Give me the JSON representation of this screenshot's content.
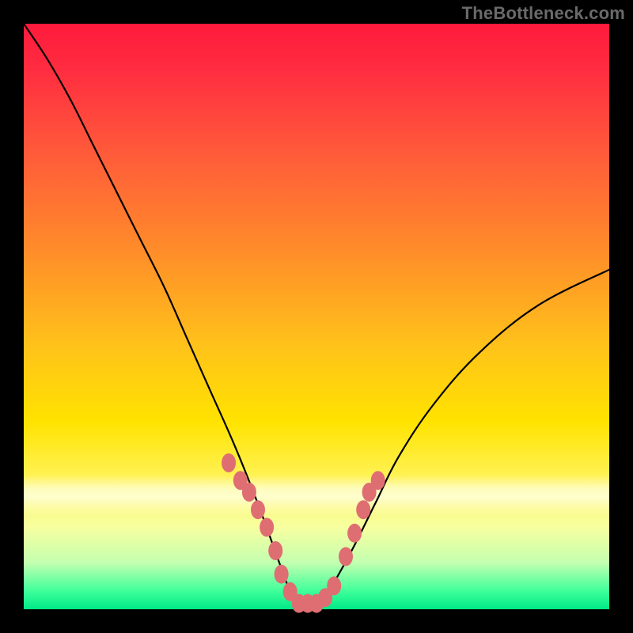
{
  "watermark": "TheBottleneck.com",
  "colors": {
    "frame": "#000000",
    "marker": "#de6e72",
    "curve": "#000000",
    "gradient_top": "#ff1a3c",
    "gradient_bottom": "#00e886"
  },
  "chart_data": {
    "type": "line",
    "title": "",
    "xlabel": "",
    "ylabel": "",
    "xlim": [
      0,
      100
    ],
    "ylim": [
      0,
      100
    ],
    "note": "Axes are unlabeled in the source image; x and y are normalized 0–100. y=0 is the bottom (green), y=100 is the top (red). Curve is a V-shaped bottleneck profile with its minimum around x≈47.",
    "series": [
      {
        "name": "bottleneck-curve",
        "x": [
          0,
          4,
          8,
          12,
          16,
          20,
          24,
          28,
          32,
          36,
          40,
          44,
          46,
          48,
          50,
          52,
          56,
          60,
          64,
          70,
          78,
          88,
          100
        ],
        "y": [
          100,
          94,
          87,
          79,
          71,
          63,
          55,
          46,
          37,
          28,
          18,
          7,
          2,
          1,
          1,
          3,
          10,
          18,
          26,
          35,
          44,
          52,
          58
        ]
      }
    ],
    "markers": {
      "name": "highlight-points",
      "note": "Salmon dots clustered on both arms of the V near the pale band and along the trough.",
      "x": [
        35,
        37,
        38.5,
        40,
        41.5,
        43,
        44,
        45.5,
        47,
        48.5,
        50,
        51.5,
        53,
        55,
        56.5,
        58,
        59,
        60.5
      ],
      "y": [
        25,
        22,
        20,
        17,
        14,
        10,
        6,
        3,
        1,
        1,
        1,
        2,
        4,
        9,
        13,
        17,
        20,
        22
      ]
    },
    "pale_band_y_range": [
      18,
      25
    ]
  }
}
